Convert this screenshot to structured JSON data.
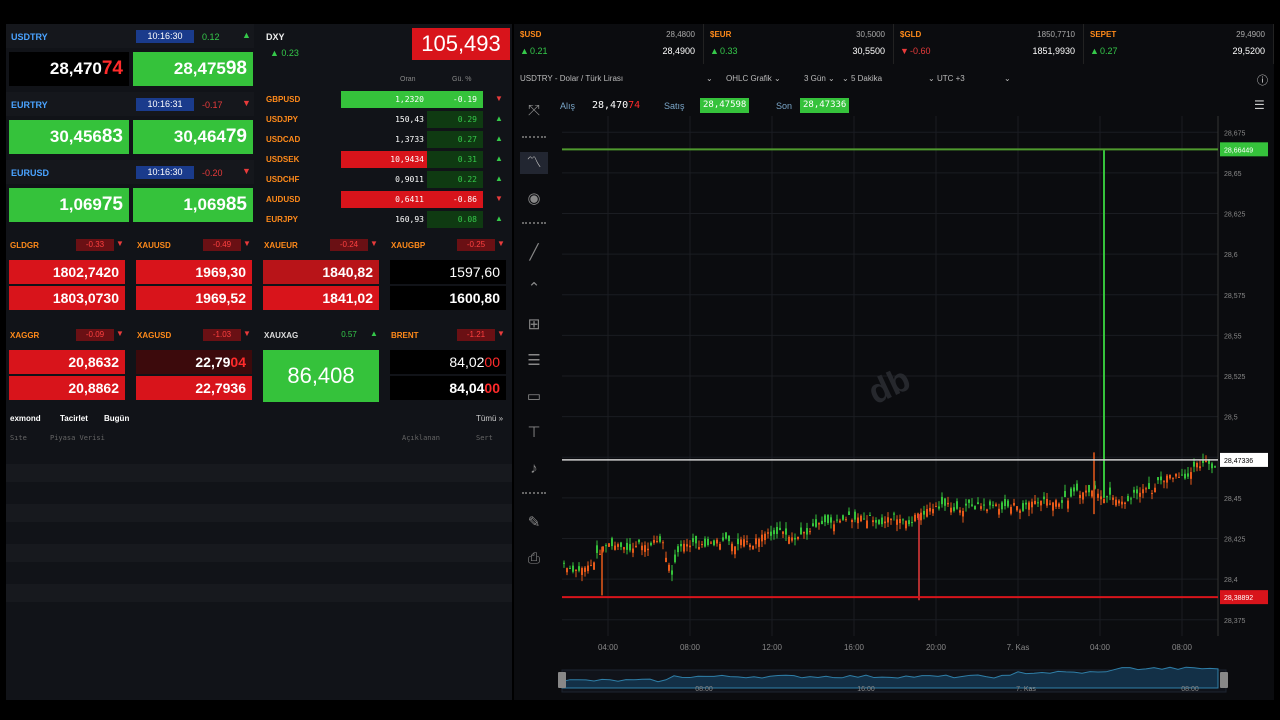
{
  "tiles": [
    {
      "sym": "USDTRY",
      "time": "10:16:30",
      "chg": "0.12",
      "dir": "up",
      "bid_main": "28,470",
      "bid_tail": "74",
      "ask_main": "28,475",
      "ask_tail": "98"
    },
    {
      "sym": "EURTRY",
      "time": "10:16:31",
      "chg": "-0.17",
      "dir": "down",
      "bid_main": "30,456",
      "bid_tail": "83",
      "ask_main": "30,464",
      "ask_tail": "79"
    },
    {
      "sym": "EURUSD",
      "time": "10:16:30",
      "chg": "-0.20",
      "dir": "down",
      "bid_main": "1,069",
      "bid_tail": "75",
      "ask_main": "1,069",
      "ask_tail": "85"
    }
  ],
  "dxy": {
    "sym": "DXY",
    "chg": "0.23",
    "value": "105,493"
  },
  "cross_head": {
    "c1": "Oran",
    "c2": "Gü. %"
  },
  "cross": [
    {
      "sym": "GBPUSD",
      "val": "1,2320",
      "chg": "-0.19",
      "dir": "down"
    },
    {
      "sym": "USDJPY",
      "val": "150,43",
      "chg": "0.29",
      "dir": "up"
    },
    {
      "sym": "USDCAD",
      "val": "1,3733",
      "chg": "0.27",
      "dir": "up"
    },
    {
      "sym": "USDSEK",
      "val": "10,9434",
      "chg": "0.31",
      "dir": "up"
    },
    {
      "sym": "USDCHF",
      "val": "0,9011",
      "chg": "0.22",
      "dir": "up"
    },
    {
      "sym": "AUDUSD",
      "val": "0,6411",
      "chg": "-0.86",
      "dir": "down"
    },
    {
      "sym": "EURJPY",
      "val": "160,93",
      "chg": "0.08",
      "dir": "up"
    }
  ],
  "metals_row1": [
    {
      "sym": "GLDGR",
      "chg": "-0.33",
      "p1": "1802,7420",
      "p2": "1803,0730"
    },
    {
      "sym": "XAUUSD",
      "chg": "-0.49",
      "p1": "1969,30",
      "p2": "1969,52"
    },
    {
      "sym": "XAUEUR",
      "chg": "-0.24",
      "p1": "1840,82",
      "p2": "1841,02"
    },
    {
      "sym": "XAUGBP",
      "chg": "-0.25",
      "p1": "1597,60",
      "p2": "1600,80"
    }
  ],
  "metals_row2": [
    {
      "sym": "XAGGR",
      "chg": "-0.09",
      "p1": "20,8632",
      "p2": "20,8862"
    },
    {
      "sym": "XAGUSD",
      "chg": "-1.03",
      "p1_main": "22,79",
      "p1_tail": "04",
      "p2": "22,7936"
    },
    {
      "sym": "XAUXAG",
      "chg": "0.57",
      "single": "86,408"
    },
    {
      "sym": "BRENT",
      "chg": "-1.21",
      "p1_main": "84,02",
      "p1_tail": "00",
      "p2_main": "84,04",
      "p2_tail": "00"
    }
  ],
  "news": {
    "tab1": "exmond",
    "tab2": "Tacirlet",
    "tab3": "Bugün",
    "all": "Tümü »",
    "col1": "Sıte",
    "col2": "Piyasa Verisi",
    "col3": "Açıklanan",
    "col4": "Sert"
  },
  "tickers": [
    {
      "sym": "$USD",
      "chg": "0.21",
      "dir": "up",
      "v1": "28,4800",
      "v2": "28,4900"
    },
    {
      "sym": "$EUR",
      "chg": "0.33",
      "dir": "up",
      "v1": "30,5000",
      "v2": "30,5500"
    },
    {
      "sym": "$GLD",
      "chg": "-0.60",
      "dir": "down",
      "v1": "1850,7710",
      "v2": "1851,9930"
    },
    {
      "sym": "SEPET",
      "chg": "0.27",
      "dir": "up",
      "v1": "29,4900",
      "v2": "29,5200"
    }
  ],
  "toolbar": {
    "title": "USDTRY - Dolar / Türk Lirası",
    "chart_type": "OHLC Grafik",
    "range": "3 Gün",
    "interval": "5 Dakika",
    "tz": "UTC +3"
  },
  "ohlc": {
    "alis_label": "Alış",
    "alis_main": "28,470",
    "alis_tail": "74",
    "satis_label": "Satış",
    "satis_value": "28,47598",
    "son_label": "Son",
    "son_value": "28,47336"
  },
  "price_axis": {
    "ticks": [
      "28,675",
      "28,65",
      "28,625",
      "28,6",
      "28,575",
      "28,55",
      "28,525",
      "28,5",
      "28,475",
      "28,45",
      "28,425",
      "28,4",
      "28,375"
    ],
    "marker_top": "28,66449",
    "marker_mid": "28,47336",
    "marker_low": "28,38892"
  },
  "time_axis": {
    "ticks": [
      "04:00",
      "08:00",
      "12:00",
      "16:00",
      "20:00",
      "7. Kas",
      "04:00",
      "08:00"
    ]
  },
  "navigator": {
    "ticks": [
      "08:00",
      "16:00",
      "7. Kas",
      "08:00"
    ]
  },
  "watermark": "db",
  "colors": {
    "up": "#35c23b",
    "down": "#d8141b",
    "accent": "#4aa3ff",
    "symbol": "#ff8a1a"
  }
}
